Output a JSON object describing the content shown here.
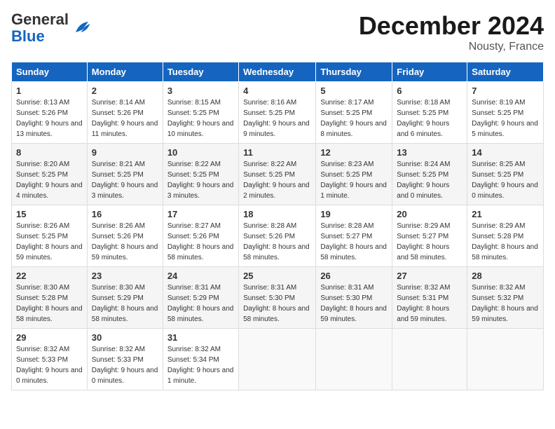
{
  "header": {
    "logo_general": "General",
    "logo_blue": "Blue",
    "month_title": "December 2024",
    "location": "Nousty, France"
  },
  "days_of_week": [
    "Sunday",
    "Monday",
    "Tuesday",
    "Wednesday",
    "Thursday",
    "Friday",
    "Saturday"
  ],
  "weeks": [
    [
      {
        "day": "1",
        "info": "Sunrise: 8:13 AM\nSunset: 5:26 PM\nDaylight: 9 hours and 13 minutes."
      },
      {
        "day": "2",
        "info": "Sunrise: 8:14 AM\nSunset: 5:26 PM\nDaylight: 9 hours and 11 minutes."
      },
      {
        "day": "3",
        "info": "Sunrise: 8:15 AM\nSunset: 5:25 PM\nDaylight: 9 hours and 10 minutes."
      },
      {
        "day": "4",
        "info": "Sunrise: 8:16 AM\nSunset: 5:25 PM\nDaylight: 9 hours and 9 minutes."
      },
      {
        "day": "5",
        "info": "Sunrise: 8:17 AM\nSunset: 5:25 PM\nDaylight: 9 hours and 8 minutes."
      },
      {
        "day": "6",
        "info": "Sunrise: 8:18 AM\nSunset: 5:25 PM\nDaylight: 9 hours and 6 minutes."
      },
      {
        "day": "7",
        "info": "Sunrise: 8:19 AM\nSunset: 5:25 PM\nDaylight: 9 hours and 5 minutes."
      }
    ],
    [
      {
        "day": "8",
        "info": "Sunrise: 8:20 AM\nSunset: 5:25 PM\nDaylight: 9 hours and 4 minutes."
      },
      {
        "day": "9",
        "info": "Sunrise: 8:21 AM\nSunset: 5:25 PM\nDaylight: 9 hours and 3 minutes."
      },
      {
        "day": "10",
        "info": "Sunrise: 8:22 AM\nSunset: 5:25 PM\nDaylight: 9 hours and 3 minutes."
      },
      {
        "day": "11",
        "info": "Sunrise: 8:22 AM\nSunset: 5:25 PM\nDaylight: 9 hours and 2 minutes."
      },
      {
        "day": "12",
        "info": "Sunrise: 8:23 AM\nSunset: 5:25 PM\nDaylight: 9 hours and 1 minute."
      },
      {
        "day": "13",
        "info": "Sunrise: 8:24 AM\nSunset: 5:25 PM\nDaylight: 9 hours and 0 minutes."
      },
      {
        "day": "14",
        "info": "Sunrise: 8:25 AM\nSunset: 5:25 PM\nDaylight: 9 hours and 0 minutes."
      }
    ],
    [
      {
        "day": "15",
        "info": "Sunrise: 8:26 AM\nSunset: 5:25 PM\nDaylight: 8 hours and 59 minutes."
      },
      {
        "day": "16",
        "info": "Sunrise: 8:26 AM\nSunset: 5:26 PM\nDaylight: 8 hours and 59 minutes."
      },
      {
        "day": "17",
        "info": "Sunrise: 8:27 AM\nSunset: 5:26 PM\nDaylight: 8 hours and 58 minutes."
      },
      {
        "day": "18",
        "info": "Sunrise: 8:28 AM\nSunset: 5:26 PM\nDaylight: 8 hours and 58 minutes."
      },
      {
        "day": "19",
        "info": "Sunrise: 8:28 AM\nSunset: 5:27 PM\nDaylight: 8 hours and 58 minutes."
      },
      {
        "day": "20",
        "info": "Sunrise: 8:29 AM\nSunset: 5:27 PM\nDaylight: 8 hours and 58 minutes."
      },
      {
        "day": "21",
        "info": "Sunrise: 8:29 AM\nSunset: 5:28 PM\nDaylight: 8 hours and 58 minutes."
      }
    ],
    [
      {
        "day": "22",
        "info": "Sunrise: 8:30 AM\nSunset: 5:28 PM\nDaylight: 8 hours and 58 minutes."
      },
      {
        "day": "23",
        "info": "Sunrise: 8:30 AM\nSunset: 5:29 PM\nDaylight: 8 hours and 58 minutes."
      },
      {
        "day": "24",
        "info": "Sunrise: 8:31 AM\nSunset: 5:29 PM\nDaylight: 8 hours and 58 minutes."
      },
      {
        "day": "25",
        "info": "Sunrise: 8:31 AM\nSunset: 5:30 PM\nDaylight: 8 hours and 58 minutes."
      },
      {
        "day": "26",
        "info": "Sunrise: 8:31 AM\nSunset: 5:30 PM\nDaylight: 8 hours and 59 minutes."
      },
      {
        "day": "27",
        "info": "Sunrise: 8:32 AM\nSunset: 5:31 PM\nDaylight: 8 hours and 59 minutes."
      },
      {
        "day": "28",
        "info": "Sunrise: 8:32 AM\nSunset: 5:32 PM\nDaylight: 8 hours and 59 minutes."
      }
    ],
    [
      {
        "day": "29",
        "info": "Sunrise: 8:32 AM\nSunset: 5:33 PM\nDaylight: 9 hours and 0 minutes."
      },
      {
        "day": "30",
        "info": "Sunrise: 8:32 AM\nSunset: 5:33 PM\nDaylight: 9 hours and 0 minutes."
      },
      {
        "day": "31",
        "info": "Sunrise: 8:32 AM\nSunset: 5:34 PM\nDaylight: 9 hours and 1 minute."
      },
      {
        "day": "",
        "info": ""
      },
      {
        "day": "",
        "info": ""
      },
      {
        "day": "",
        "info": ""
      },
      {
        "day": "",
        "info": ""
      }
    ]
  ]
}
